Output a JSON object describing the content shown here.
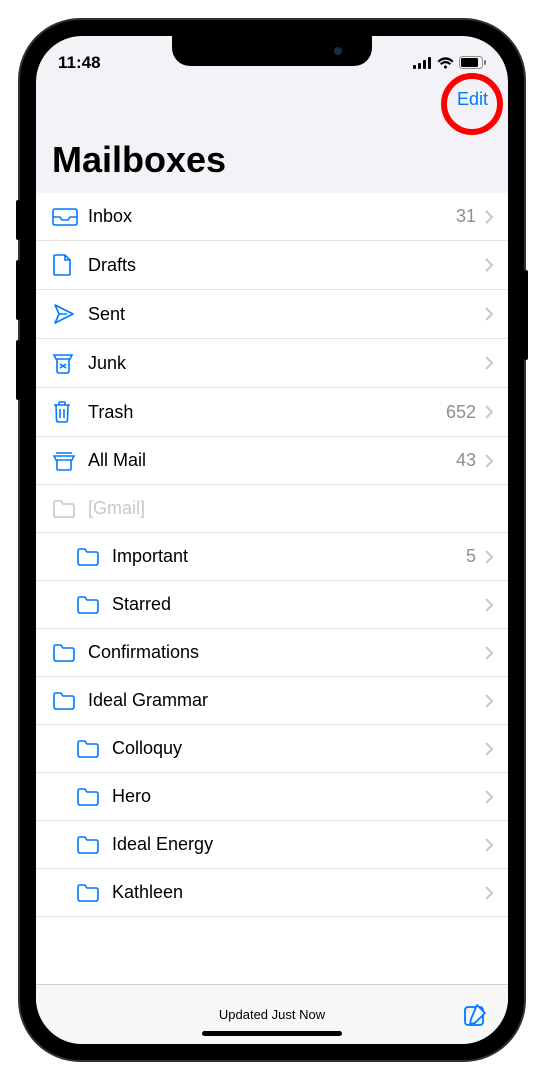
{
  "statusBar": {
    "time": "11:48"
  },
  "header": {
    "editLabel": "Edit",
    "title": "Mailboxes"
  },
  "mailboxes": [
    {
      "icon": "inbox",
      "label": "Inbox",
      "count": "31",
      "indent": 0,
      "disabled": false,
      "showChevron": true
    },
    {
      "icon": "drafts",
      "label": "Drafts",
      "count": "",
      "indent": 0,
      "disabled": false,
      "showChevron": true
    },
    {
      "icon": "sent",
      "label": "Sent",
      "count": "",
      "indent": 0,
      "disabled": false,
      "showChevron": true
    },
    {
      "icon": "junk",
      "label": "Junk",
      "count": "",
      "indent": 0,
      "disabled": false,
      "showChevron": true
    },
    {
      "icon": "trash",
      "label": "Trash",
      "count": "652",
      "indent": 0,
      "disabled": false,
      "showChevron": true
    },
    {
      "icon": "allmail",
      "label": "All Mail",
      "count": "43",
      "indent": 0,
      "disabled": false,
      "showChevron": true
    },
    {
      "icon": "folder-gray",
      "label": "[Gmail]",
      "count": "",
      "indent": 0,
      "disabled": true,
      "showChevron": false
    },
    {
      "icon": "folder",
      "label": "Important",
      "count": "5",
      "indent": 1,
      "disabled": false,
      "showChevron": true
    },
    {
      "icon": "folder",
      "label": "Starred",
      "count": "",
      "indent": 1,
      "disabled": false,
      "showChevron": true
    },
    {
      "icon": "folder",
      "label": "Confirmations",
      "count": "",
      "indent": 0,
      "disabled": false,
      "showChevron": true
    },
    {
      "icon": "folder",
      "label": "Ideal Grammar",
      "count": "",
      "indent": 0,
      "disabled": false,
      "showChevron": true
    },
    {
      "icon": "folder",
      "label": "Colloquy",
      "count": "",
      "indent": 1,
      "disabled": false,
      "showChevron": true
    },
    {
      "icon": "folder",
      "label": "Hero",
      "count": "",
      "indent": 1,
      "disabled": false,
      "showChevron": true
    },
    {
      "icon": "folder",
      "label": "Ideal Energy",
      "count": "",
      "indent": 1,
      "disabled": false,
      "showChevron": true
    },
    {
      "icon": "folder",
      "label": "Kathleen",
      "count": "",
      "indent": 1,
      "disabled": false,
      "showChevron": true
    }
  ],
  "toolbar": {
    "status": "Updated Just Now"
  }
}
